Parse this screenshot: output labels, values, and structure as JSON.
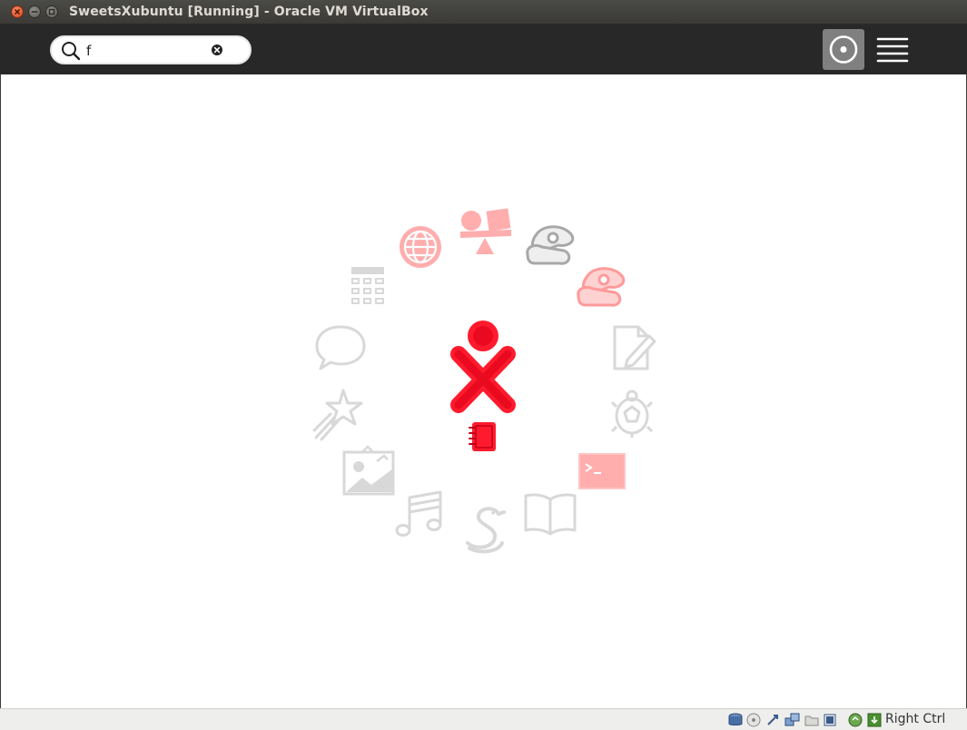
{
  "window": {
    "title": "SweetsXubuntu [Running] - Oracle VM VirtualBox"
  },
  "toolbar": {
    "search_value": "f",
    "icons": [
      "search-icon",
      "clear-icon",
      "ring-view-icon",
      "list-view-icon"
    ]
  },
  "home": {
    "center_icon": "xo-buddy-icon",
    "journal_icon": "journal-icon",
    "activities": [
      {
        "name": "browse",
        "icon": "globe-icon",
        "state": "highlight"
      },
      {
        "name": "chat-share",
        "icon": "people-shapes-icon",
        "state": "highlight"
      },
      {
        "name": "ruler-mouse",
        "icon": "mouse-plane-icon",
        "state": "dim"
      },
      {
        "name": "paint",
        "icon": "mouse-plane-icon",
        "state": "highlight"
      },
      {
        "name": "write",
        "icon": "write-icon",
        "state": "dim"
      },
      {
        "name": "turtle",
        "icon": "turtle-icon",
        "state": "dim"
      },
      {
        "name": "terminal",
        "icon": "terminal-icon",
        "state": "highlight"
      },
      {
        "name": "read",
        "icon": "book-icon",
        "state": "dim"
      },
      {
        "name": "pippy",
        "icon": "snake-icon",
        "state": "dim"
      },
      {
        "name": "music",
        "icon": "music-note-icon",
        "state": "dim"
      },
      {
        "name": "image-viewer",
        "icon": "image-icon",
        "state": "dim"
      },
      {
        "name": "fototoon",
        "icon": "shooting-star-icon",
        "state": "dim"
      },
      {
        "name": "chat",
        "icon": "speech-bubble-icon",
        "state": "dim"
      },
      {
        "name": "calculate",
        "icon": "calculator-icon",
        "state": "dim"
      }
    ],
    "colors": {
      "highlight": "#ffadad",
      "dim": "#d8d8d8",
      "xo": "#ff1b2d"
    }
  },
  "statusbar": {
    "host_key": "Right Ctrl",
    "icons": [
      "hard-disk-icon",
      "optical-drive-icon",
      "usb-icon",
      "network-icon",
      "shared-folder-icon",
      "display-icon",
      "capture-icon",
      "mouse-integration-icon"
    ]
  }
}
